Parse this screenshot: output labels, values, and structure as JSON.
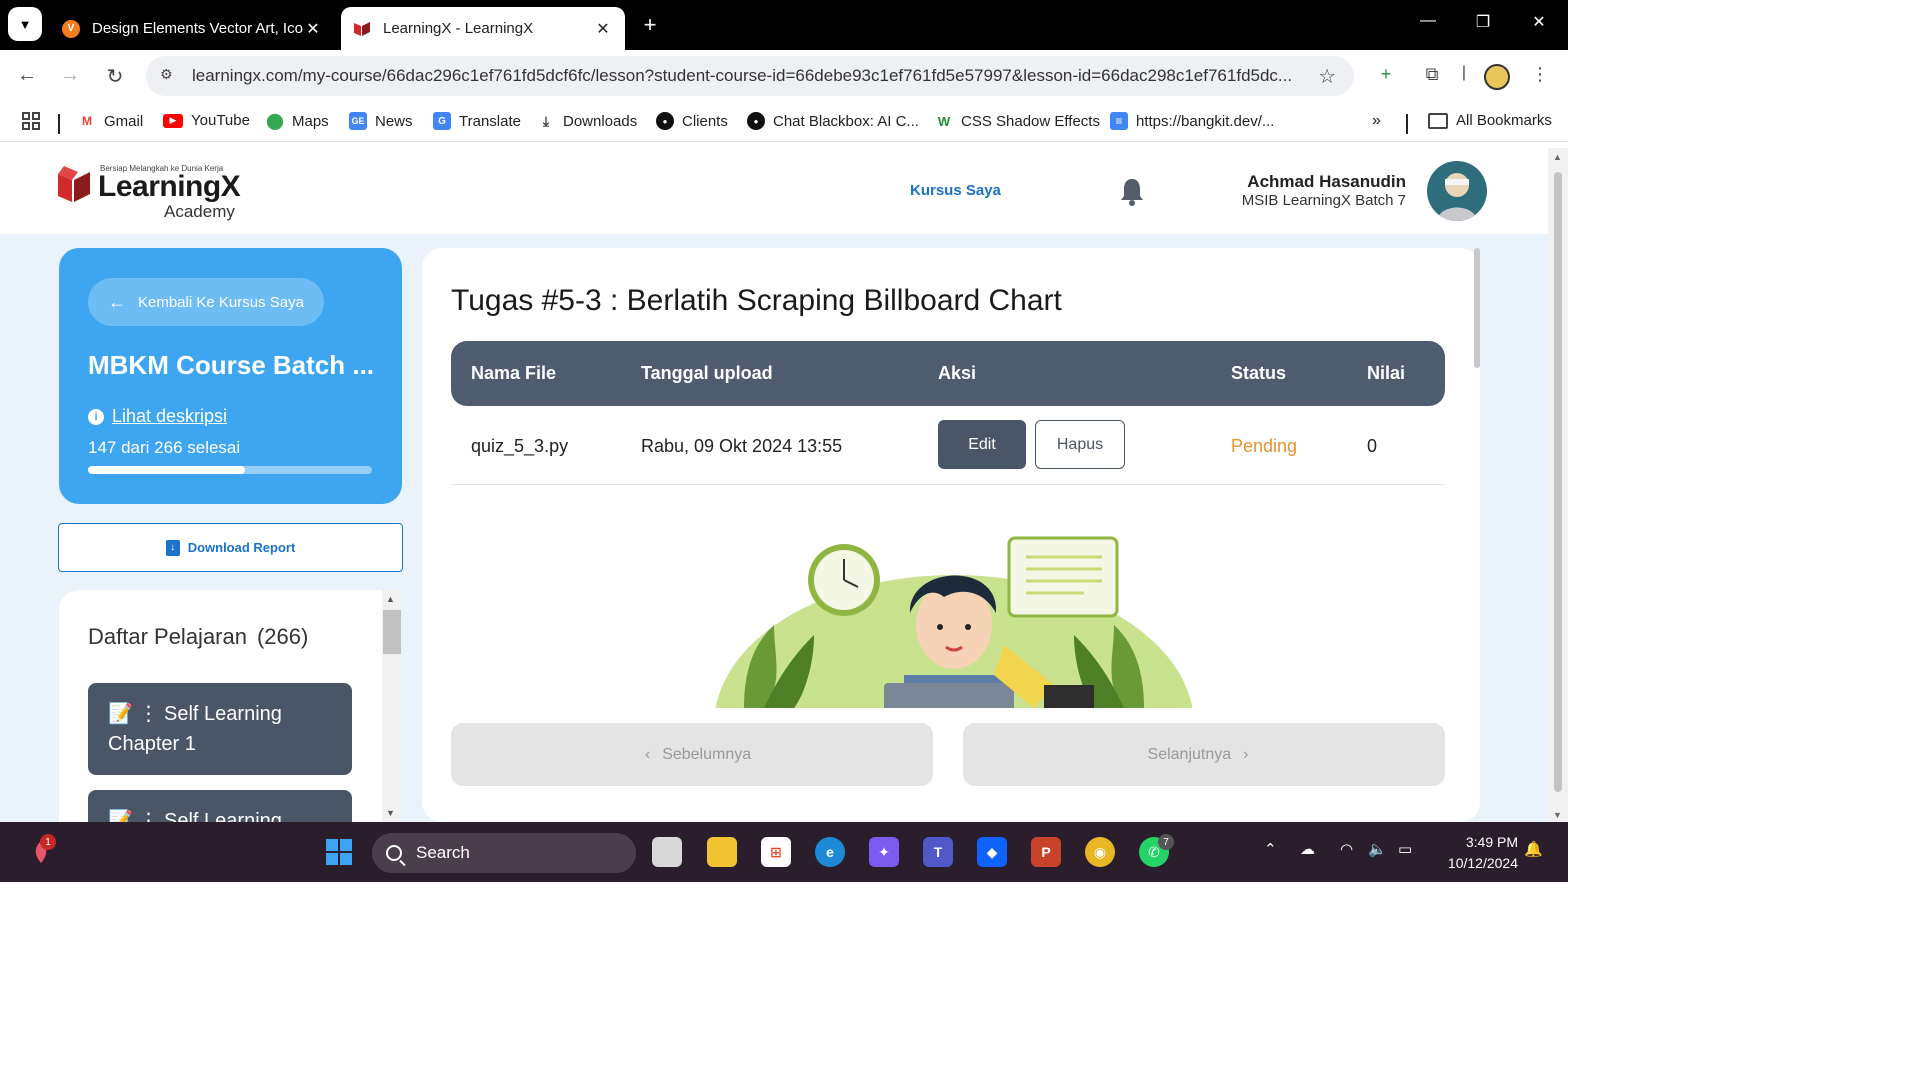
{
  "browser": {
    "tabs": [
      {
        "title": "Design Elements Vector Art, Ico",
        "active": false,
        "favicon": "vecteezy-icon"
      },
      {
        "title": "LearningX - LearningX",
        "active": true,
        "favicon": "learningx-icon"
      }
    ],
    "url": "learningx.com/my-course/66dac296c1ef761fd5dcf6fc/lesson?student-course-id=66debe93c1ef761fd5e57997&lesson-id=66dac298c1ef761fd5dc...",
    "bookmarks": [
      {
        "label": "Gmail",
        "icon": "gmail-icon"
      },
      {
        "label": "YouTube",
        "icon": "youtube-icon"
      },
      {
        "label": "Maps",
        "icon": "maps-icon"
      },
      {
        "label": "News",
        "icon": "news-icon"
      },
      {
        "label": "Translate",
        "icon": "translate-icon"
      },
      {
        "label": "Downloads",
        "icon": "download-icon"
      },
      {
        "label": "Clients",
        "icon": "clients-icon"
      },
      {
        "label": "Chat Blackbox: AI C...",
        "icon": "blackbox-icon"
      },
      {
        "label": "CSS Shadow Effects",
        "icon": "css-icon"
      },
      {
        "label": "https://bangkit.dev/...",
        "icon": "document-icon"
      }
    ],
    "all_bookmarks": "All Bookmarks"
  },
  "header": {
    "logo_tagline": "Bersiap Melangkah ke Dunia Kerja",
    "logo_brand": "LearningX",
    "logo_sub": "Academy",
    "nav_link": "Kursus Saya",
    "user_name": "Achmad Hasanudin",
    "user_role": "MSIB LearningX Batch 7"
  },
  "sidebar": {
    "back_label": "Kembali Ke Kursus Saya",
    "course_title": "MBKM Course Batch ...",
    "description_link": "Lihat deskripsi",
    "progress_text": "147 dari 266 selesai",
    "progress_done": 147,
    "progress_total": 266,
    "download_label": "Download Report",
    "lessons_title": "Daftar Pelajaran",
    "lessons_count": "(266)",
    "lessons": [
      {
        "label": "📝 ⋮ Self Learning Chapter 1"
      },
      {
        "label": "📝 ⋮ Self Learning"
      }
    ]
  },
  "main": {
    "task_title": "Tugas #5-3 : Berlatih Scraping Billboard Chart",
    "table": {
      "headers": [
        "Nama File",
        "Tanggal upload",
        "Aksi",
        "Status",
        "Nilai"
      ],
      "rows": [
        {
          "file": "quiz_5_3.py",
          "date": "Rabu, 09 Okt 2024 13:55",
          "edit": "Edit",
          "delete": "Hapus",
          "status": "Pending",
          "score": "0"
        }
      ]
    },
    "prev_label": "Sebelumnya",
    "next_label": "Selanjutnya"
  },
  "taskbar": {
    "search_placeholder": "Search",
    "time": "3:49 PM",
    "date": "10/12/2024",
    "teams_badge": "1",
    "whatsapp_badge": "7"
  },
  "colors": {
    "accent_blue": "#3ea6f0",
    "link_blue": "#1a73c8",
    "dark_slate": "#4a5568",
    "pending_orange": "#e8912d"
  }
}
